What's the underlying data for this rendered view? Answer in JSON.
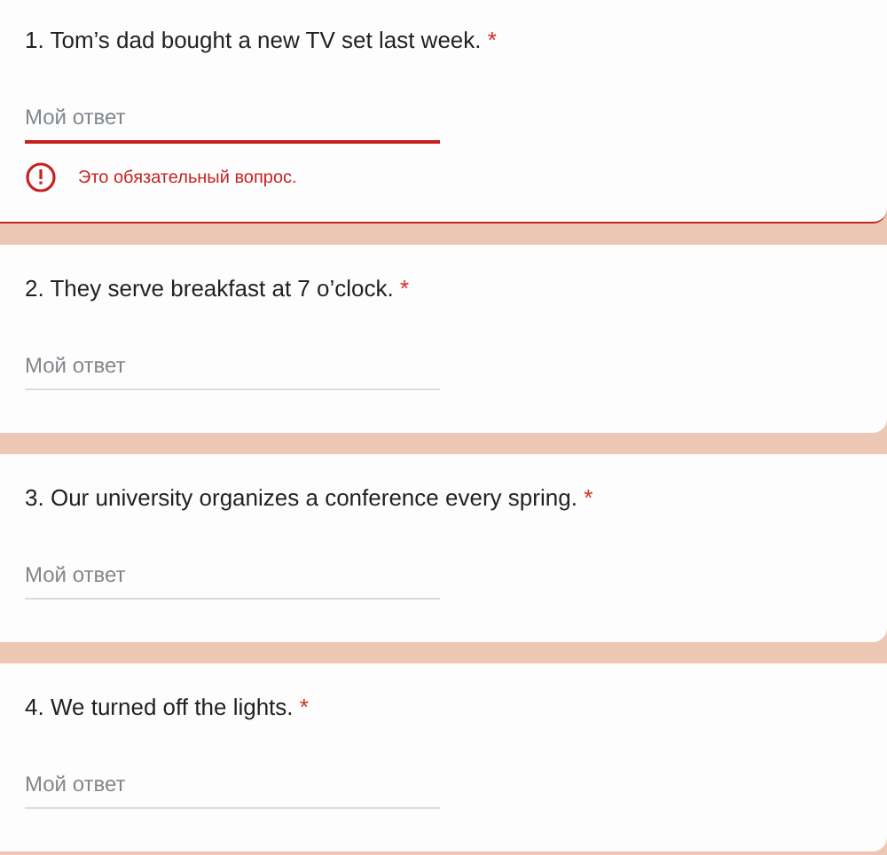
{
  "questions": [
    {
      "title": "1. Tom’s dad bought a new TV set last week.",
      "required_mark": "*",
      "placeholder": "Мой ответ",
      "focused": true,
      "error": "Это обязательный вопрос."
    },
    {
      "title": "2. They serve breakfast at 7 o’clock.",
      "required_mark": "*",
      "placeholder": "Мой ответ",
      "focused": false
    },
    {
      "title": "3. Our university organizes a conference every spring.",
      "required_mark": "*",
      "placeholder": "Мой ответ",
      "focused": false
    },
    {
      "title": "4. We turned off the lights.",
      "required_mark": "*",
      "placeholder": "Мой ответ",
      "focused": false
    }
  ]
}
